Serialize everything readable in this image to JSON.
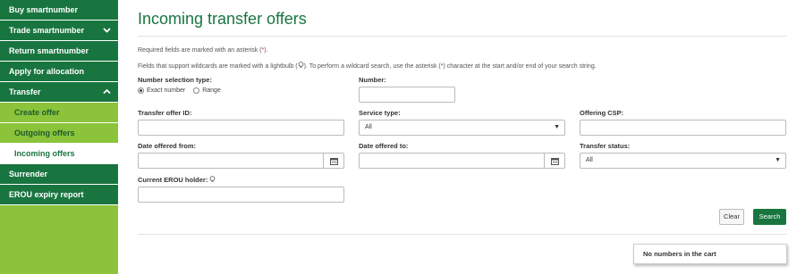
{
  "sidebar": {
    "items": [
      {
        "label": "Buy smartnumber"
      },
      {
        "label": "Trade smartnumber",
        "chevron": "chevron-down"
      },
      {
        "label": "Return smartnumber"
      },
      {
        "label": "Apply for allocation"
      },
      {
        "label": "Transfer",
        "chevron": "chevron-up"
      }
    ],
    "sub_items": [
      {
        "label": "Create offer"
      },
      {
        "label": "Outgoing offers"
      },
      {
        "label": "Incoming offers",
        "active": true
      }
    ],
    "bottom_items": [
      {
        "label": "Surrender"
      },
      {
        "label": "EROU expiry report"
      }
    ]
  },
  "page": {
    "title": "Incoming transfer offers",
    "required_note_prefix": "Required fields are marked with an asterisk (",
    "required_note_asterisk": "*",
    "required_note_suffix": ").",
    "wildcard_note_prefix": "Fields that support wildcards are marked with a lightbulb (",
    "wildcard_note_suffix": "). To perform a wildcard search, use the asterisk (*) character at the start and/or end of your search string."
  },
  "form": {
    "number_selection_type": {
      "label": "Number selection type:",
      "options": [
        "Exact number",
        "Range"
      ],
      "selected": "Exact number"
    },
    "number": {
      "label": "Number:",
      "value": ""
    },
    "transfer_offer_id": {
      "label": "Transfer offer ID:",
      "value": ""
    },
    "service_type": {
      "label": "Service type:",
      "value": "All"
    },
    "offering_csp": {
      "label": "Offering CSP:",
      "value": ""
    },
    "date_offered_from": {
      "label": "Date offered from:",
      "value": ""
    },
    "date_offered_to": {
      "label": "Date offered to:",
      "value": ""
    },
    "transfer_status": {
      "label": "Transfer status:",
      "value": "All"
    },
    "current_erou_holder": {
      "label": "Current EROU holder:",
      "value": ""
    }
  },
  "buttons": {
    "clear": "Clear",
    "search": "Search"
  },
  "cart": {
    "text": "No numbers in the cart"
  },
  "colors": {
    "brand_green": "#197540",
    "sidebar_light_green": "#8bc33a",
    "required_asterisk": "#c0392b"
  }
}
